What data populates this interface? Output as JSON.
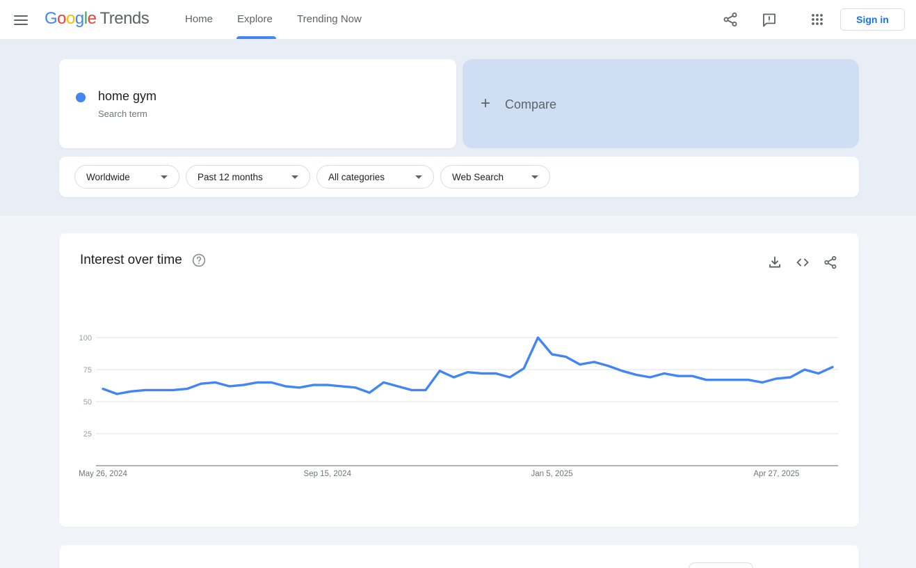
{
  "brand": {
    "google_letter_colors": [
      "#4285F4",
      "#EA4335",
      "#FBBC05",
      "#4285F4",
      "#34A853",
      "#EA4335"
    ],
    "accent_blue": "#4285f4",
    "link_blue": "#1a73e8"
  },
  "header": {
    "logo_google": "Google",
    "logo_trends": "Trends",
    "nav": [
      {
        "label": "Home",
        "active": false
      },
      {
        "label": "Explore",
        "active": true
      },
      {
        "label": "Trending Now",
        "active": false
      }
    ],
    "sign_in_label": "Sign in"
  },
  "icons": {
    "menu": "hamburger",
    "share": "share-nodes",
    "feedback": "exclamation-speech-bubble",
    "apps": "3x3-dot-grid",
    "download": "arrow-down-into-tray",
    "embed": "angle-brackets",
    "help": "question-mark-circle",
    "dropdown": "caret-down"
  },
  "query_bar": {
    "term": "home gym",
    "term_type": "Search term",
    "compare_plus": "+",
    "compare_label": "Compare"
  },
  "filters": {
    "region": "Worldwide",
    "time": "Past 12 months",
    "category": "All categories",
    "search_type": "Web Search"
  },
  "interest_card": {
    "title": "Interest over time"
  },
  "chart_data": {
    "type": "line",
    "title": "Interest over time",
    "series": [
      {
        "name": "home gym",
        "color": "#4285f4",
        "values": [
          60,
          56,
          58,
          59,
          59,
          59,
          60,
          64,
          65,
          62,
          63,
          65,
          65,
          62,
          61,
          63,
          63,
          62,
          61,
          57,
          65,
          62,
          59,
          59,
          74,
          69,
          73,
          72,
          72,
          69,
          76,
          100,
          87,
          85,
          79,
          81,
          78,
          74,
          71,
          69,
          72,
          70,
          70,
          67,
          67,
          67,
          67,
          65,
          68,
          69,
          75,
          72,
          77
        ]
      }
    ],
    "x_start_date": "May 26, 2024",
    "x_interval": "weekly",
    "x_tick_labels": [
      "May 26, 2024",
      "Sep 15, 2024",
      "Jan 5, 2025",
      "Apr 27, 2025"
    ],
    "x_tick_week_indices": [
      0,
      16,
      32,
      48
    ],
    "y_ticks": [
      100,
      75,
      50,
      25
    ],
    "ylim": [
      0,
      100
    ],
    "grid": true,
    "legend": "none"
  },
  "colors": {
    "bg_top": "#e9edf6",
    "bg_main": "#f1f4f9",
    "compare_card_bg": "#cfdef2",
    "grid_line": "#e0e0e0",
    "axis_line": "#80868b",
    "y_tick_text": "#9aa0a6",
    "x_tick_text": "#70757a",
    "nav_text": "#5f6368"
  }
}
